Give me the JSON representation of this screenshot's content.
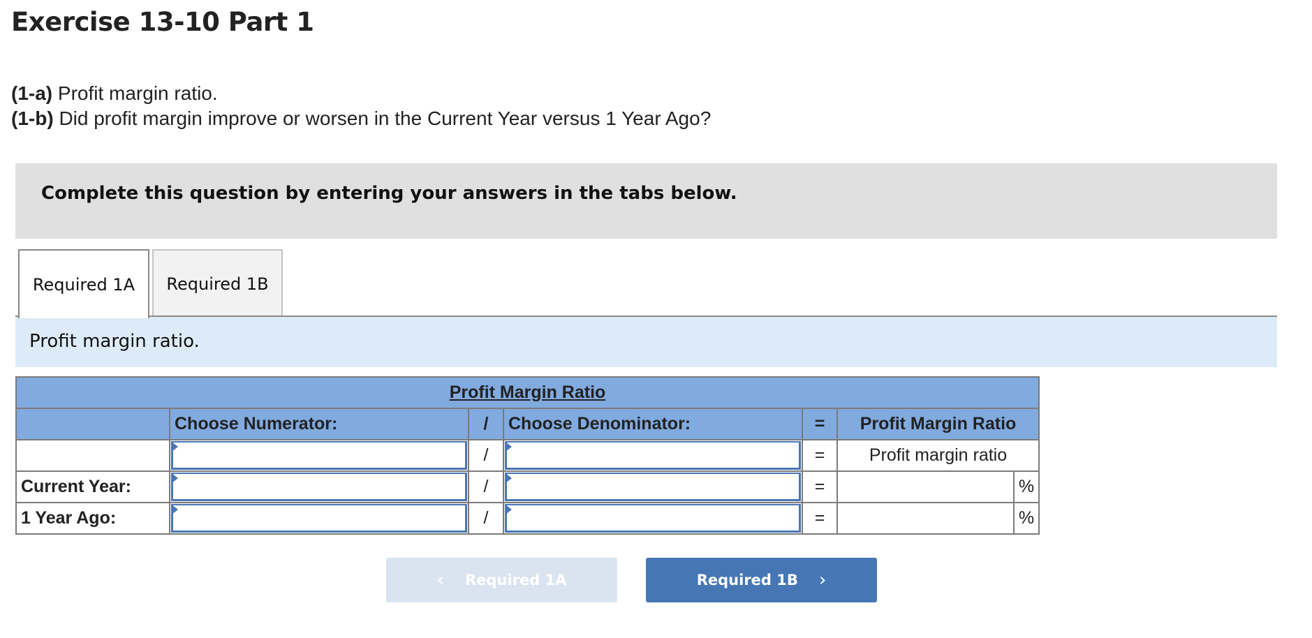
{
  "page": {
    "title": "Exercise 13-10 Part 1",
    "questions": [
      {
        "tag": "(1-a)",
        "text": "Profit margin ratio."
      },
      {
        "tag": "(1-b)",
        "text": "Did profit margin improve or worsen in the Current Year versus 1 Year Ago?"
      }
    ],
    "instruction": "Complete this question by entering your answers in the tabs below."
  },
  "tabs": [
    {
      "label": "Required 1A",
      "active": true
    },
    {
      "label": "Required 1B",
      "active": false
    }
  ],
  "panel": {
    "prompt": "Profit margin ratio.",
    "table": {
      "title": "Profit Margin Ratio",
      "headers": {
        "numerator": "Choose Numerator:",
        "divide": "/",
        "denominator": "Choose Denominator:",
        "equals": "=",
        "result": "Profit Margin Ratio"
      },
      "rows": [
        {
          "label": "",
          "numerator": "",
          "divide": "/",
          "denominator": "",
          "equals": "=",
          "result": "Profit margin ratio",
          "unit": ""
        },
        {
          "label": "Current Year:",
          "numerator": "",
          "divide": "/",
          "denominator": "",
          "equals": "=",
          "result": "",
          "unit": "%"
        },
        {
          "label": "1 Year Ago:",
          "numerator": "",
          "divide": "/",
          "denominator": "",
          "equals": "=",
          "result": "",
          "unit": "%"
        }
      ]
    }
  },
  "nav": {
    "prev_label": "Required 1A",
    "prev_icon": "chevron-left-icon",
    "prev_enabled": false,
    "next_label": "Required 1B",
    "next_icon": "chevron-right-icon",
    "next_enabled": true,
    "chevron_left": "‹",
    "chevron_right": "›"
  },
  "colors": {
    "header_blue": "#81aadf",
    "prompt_bg": "#ddebf8",
    "instruction_bg": "#e0e0e0",
    "button_primary": "#4677b4",
    "button_disabled": "#dae4f0",
    "input_border": "#4a76b5"
  }
}
